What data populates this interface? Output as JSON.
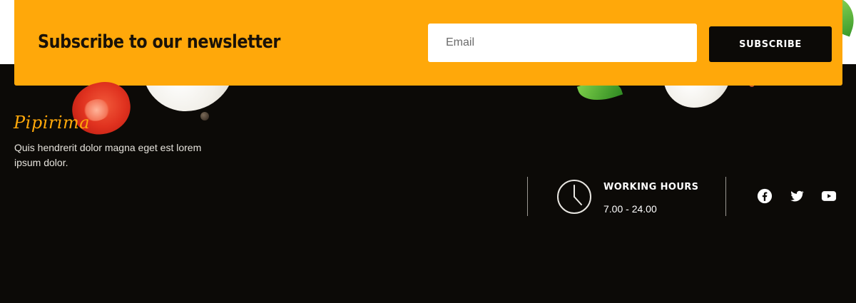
{
  "newsletter": {
    "title": "Subscribe to our newsletter",
    "email_placeholder": "Email",
    "button_label": "SUBSCRIBE",
    "background_color": "#ffa80a"
  },
  "brand": {
    "logo_text": "Pipirima",
    "description": "Quis hendrerit dolor magna eget est lorem ipsum dolor."
  },
  "hours": {
    "label": "WORKING HOURS",
    "value": "7.00 - 24.00",
    "icon": "clock-icon"
  },
  "social": {
    "icons": [
      "facebook-icon",
      "twitter-icon",
      "youtube-icon"
    ]
  },
  "colors": {
    "accent": "#ffa80a",
    "footer_bg": "#0c0a07"
  }
}
